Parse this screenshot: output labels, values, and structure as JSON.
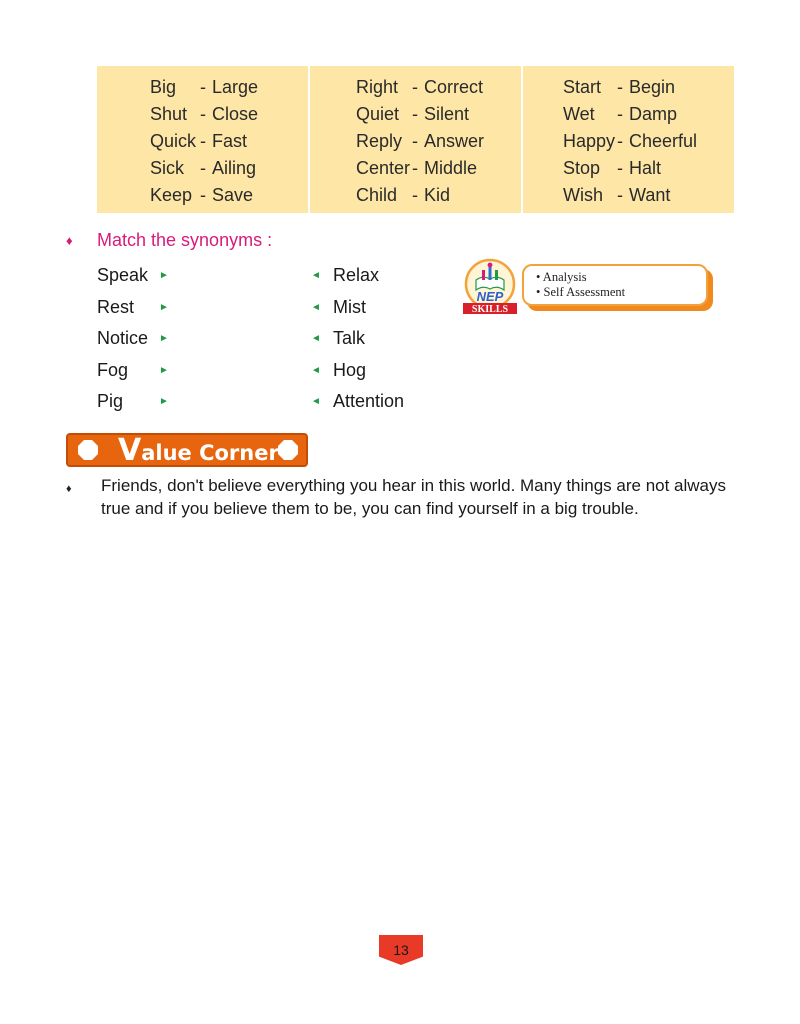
{
  "synonym_columns": [
    [
      {
        "word": "Big",
        "synonym": "Large"
      },
      {
        "word": "Shut",
        "synonym": "Close"
      },
      {
        "word": "Quick",
        "synonym": "Fast"
      },
      {
        "word": "Sick",
        "synonym": "Ailing"
      },
      {
        "word": "Keep",
        "synonym": "Save"
      }
    ],
    [
      {
        "word": "Right",
        "synonym": "Correct"
      },
      {
        "word": "Quiet",
        "synonym": "Silent"
      },
      {
        "word": "Reply",
        "synonym": "Answer"
      },
      {
        "word": "Center",
        "synonym": "Middle"
      },
      {
        "word": "Child",
        "synonym": "Kid"
      }
    ],
    [
      {
        "word": "Start",
        "synonym": "Begin"
      },
      {
        "word": "Wet",
        "synonym": "Damp"
      },
      {
        "word": "Happy",
        "synonym": "Cheerful"
      },
      {
        "word": "Stop",
        "synonym": "Halt"
      },
      {
        "word": "Wish",
        "synonym": "Want"
      }
    ]
  ],
  "dash": "-",
  "match_section": {
    "bullet": "♦",
    "heading": "Match the synonyms :",
    "left_words": [
      "Speak",
      "Rest",
      "Notice",
      "Fog",
      "Pig"
    ],
    "right_words": [
      "Relax",
      "Mist",
      "Talk",
      "Hog",
      "Attention"
    ],
    "right_arrow": "►",
    "left_arrow": "◄"
  },
  "nep_skills": {
    "badge_top": "NEP",
    "badge_bottom": "SKILLS",
    "items": [
      "• Analysis",
      "• Self Assessment"
    ]
  },
  "value_corner": {
    "title_initial": "V",
    "title_rest": "alue Corner",
    "bullet": "♦",
    "text": "Friends, don't believe everything you hear in this world. Many things are not always true and if you believe them to be, you can find yourself in a big trouble."
  },
  "page_number": "13",
  "colors": {
    "box_fill": "#fde6a6",
    "heading": "#d81b7a",
    "arrow": "#1f9a4a",
    "banner": "#e8650f",
    "page_tab": "#e83a26"
  }
}
